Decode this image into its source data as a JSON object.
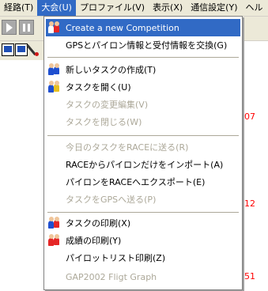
{
  "menubar": {
    "items": [
      {
        "label": "経路(T)"
      },
      {
        "label": "大会(U)"
      },
      {
        "label": "プロファイル(V)"
      },
      {
        "label": "表示(X)"
      },
      {
        "label": "通信設定(Y)"
      },
      {
        "label": "ヘル"
      }
    ]
  },
  "background": {
    "numbers": [
      "07",
      "12",
      "51"
    ]
  },
  "menu": {
    "items": [
      {
        "label": "Create a new Competition",
        "state": "highlighted",
        "icon": "competition-icon"
      },
      {
        "label": "GPSとパイロン情報と受付情報を交換(G)",
        "state": "enabled",
        "icon": ""
      },
      {
        "label": "新しいタスクの作成(T)",
        "state": "enabled",
        "icon": "new-task-icon"
      },
      {
        "label": "タスクを開く(U)",
        "state": "enabled",
        "icon": "open-task-icon"
      },
      {
        "label": "タスクの変更編集(V)",
        "state": "disabled",
        "icon": ""
      },
      {
        "label": "タスクを閉じる(W)",
        "state": "disabled",
        "icon": ""
      },
      {
        "label": "今日のタスクをRACEに送る(R)",
        "state": "disabled",
        "icon": ""
      },
      {
        "label": "RACEからパイロンだけをインポート(A)",
        "state": "enabled",
        "icon": ""
      },
      {
        "label": "パイロンをRACEへエクスポート(E)",
        "state": "enabled",
        "icon": ""
      },
      {
        "label": "タスクをGPSへ送る(P)",
        "state": "disabled",
        "icon": ""
      },
      {
        "label": "タスクの印刷(X)",
        "state": "enabled",
        "icon": "print-task-icon"
      },
      {
        "label": "成績の印刷(Y)",
        "state": "enabled",
        "icon": "print-results-icon"
      },
      {
        "label": "パイロットリスト印刷(Z)",
        "state": "enabled",
        "icon": ""
      },
      {
        "label": "GAP2002 Fligt Graph",
        "state": "disabled",
        "icon": ""
      }
    ]
  },
  "colors": {
    "highlight": "#316ac5",
    "disabled_text": "#aca899",
    "menubar_bg": "#ece9d8",
    "red_numbers": "#ff0000"
  }
}
